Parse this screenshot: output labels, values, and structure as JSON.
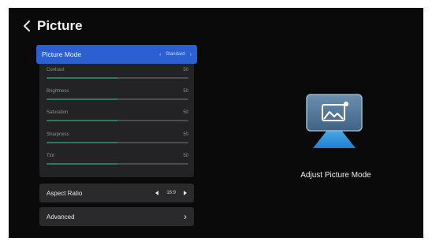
{
  "header": {
    "back_icon": "chevron-left-icon",
    "title": "Picture"
  },
  "picture_mode": {
    "label": "Picture Mode",
    "value": "Standard"
  },
  "sliders": [
    {
      "label": "Contrast",
      "value": "50",
      "level": 0.5
    },
    {
      "label": "Brightness",
      "value": "50",
      "level": 0.5
    },
    {
      "label": "Saturation",
      "value": "50",
      "level": 0.5
    },
    {
      "label": "Sharpness",
      "value": "50",
      "level": 0.5
    },
    {
      "label": "Tint",
      "value": "50",
      "level": 0.5
    }
  ],
  "aspect_ratio": {
    "label": "Aspect Ratio",
    "value": "16:9"
  },
  "advanced": {
    "label": "Advanced"
  },
  "preview": {
    "icon": "picture-mode-icon",
    "caption": "Adjust Picture Mode"
  },
  "colors": {
    "accent": "#2c5fd0",
    "slider_fill": "#2f7a5c",
    "preview_beam": "#2e8fd8"
  }
}
